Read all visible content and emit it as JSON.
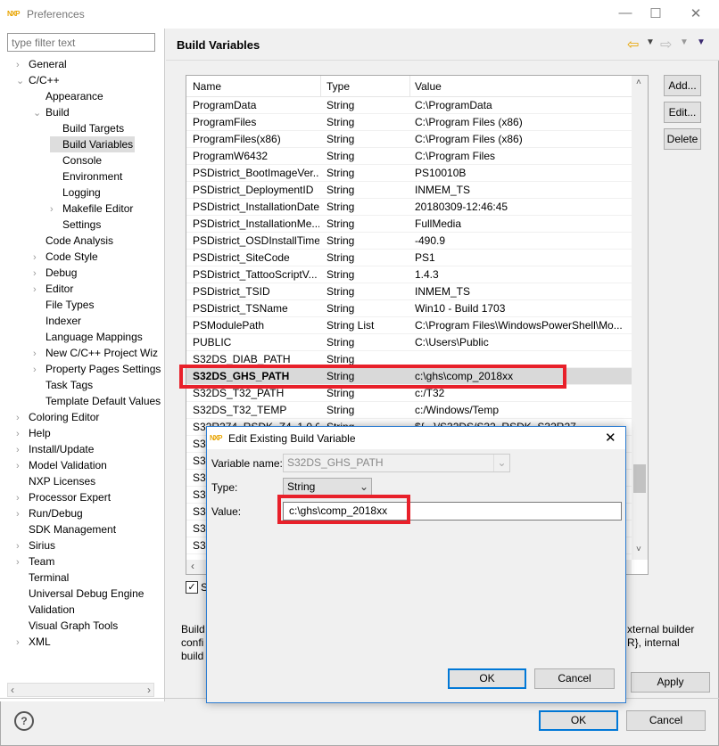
{
  "window": {
    "title": "Preferences",
    "logo": "NXP",
    "minimize": "—",
    "maximize": "☐",
    "close": "✕"
  },
  "sidebar": {
    "filter_placeholder": "type filter text",
    "items": [
      {
        "label": "General",
        "level": 0,
        "twisty": "›"
      },
      {
        "label": "C/C++",
        "level": 0,
        "twisty": "⌄"
      },
      {
        "label": "Appearance",
        "level": 1,
        "twisty": ""
      },
      {
        "label": "Build",
        "level": 1,
        "twisty": "⌄"
      },
      {
        "label": "Build Targets",
        "level": 2,
        "twisty": ""
      },
      {
        "label": "Build Variables",
        "level": 2,
        "twisty": "",
        "selected": true
      },
      {
        "label": "Console",
        "level": 2,
        "twisty": ""
      },
      {
        "label": "Environment",
        "level": 2,
        "twisty": ""
      },
      {
        "label": "Logging",
        "level": 2,
        "twisty": ""
      },
      {
        "label": "Makefile Editor",
        "level": 2,
        "twisty": "›"
      },
      {
        "label": "Settings",
        "level": 2,
        "twisty": ""
      },
      {
        "label": "Code Analysis",
        "level": 1,
        "twisty": ""
      },
      {
        "label": "Code Style",
        "level": 1,
        "twisty": "›"
      },
      {
        "label": "Debug",
        "level": 1,
        "twisty": "›"
      },
      {
        "label": "Editor",
        "level": 1,
        "twisty": "›"
      },
      {
        "label": "File Types",
        "level": 1,
        "twisty": ""
      },
      {
        "label": "Indexer",
        "level": 1,
        "twisty": ""
      },
      {
        "label": "Language Mappings",
        "level": 1,
        "twisty": ""
      },
      {
        "label": "New C/C++ Project Wiz",
        "level": 1,
        "twisty": "›"
      },
      {
        "label": "Property Pages Settings",
        "level": 1,
        "twisty": "›"
      },
      {
        "label": "Task Tags",
        "level": 1,
        "twisty": ""
      },
      {
        "label": "Template Default Values",
        "level": 1,
        "twisty": ""
      },
      {
        "label": "Coloring Editor",
        "level": 0,
        "twisty": "›"
      },
      {
        "label": "Help",
        "level": 0,
        "twisty": "›"
      },
      {
        "label": "Install/Update",
        "level": 0,
        "twisty": "›"
      },
      {
        "label": "Model Validation",
        "level": 0,
        "twisty": "›"
      },
      {
        "label": "NXP Licenses",
        "level": 0,
        "twisty": ""
      },
      {
        "label": "Processor Expert",
        "level": 0,
        "twisty": "›"
      },
      {
        "label": "Run/Debug",
        "level": 0,
        "twisty": "›"
      },
      {
        "label": "SDK Management",
        "level": 0,
        "twisty": ""
      },
      {
        "label": "Sirius",
        "level": 0,
        "twisty": "›"
      },
      {
        "label": "Team",
        "level": 0,
        "twisty": "›"
      },
      {
        "label": "Terminal",
        "level": 0,
        "twisty": ""
      },
      {
        "label": "Universal Debug Engine",
        "level": 0,
        "twisty": ""
      },
      {
        "label": "Validation",
        "level": 0,
        "twisty": ""
      },
      {
        "label": "Visual Graph Tools",
        "level": 0,
        "twisty": ""
      },
      {
        "label": "XML",
        "level": 0,
        "twisty": "›"
      }
    ]
  },
  "page": {
    "title": "Build Variables",
    "nav": {
      "back": "⇦",
      "forward": "⇨",
      "menu": "▾"
    }
  },
  "table": {
    "columns": [
      "Name",
      "Type",
      "Value"
    ],
    "rows": [
      [
        "ProgramData",
        "String",
        "C:\\ProgramData"
      ],
      [
        "ProgramFiles",
        "String",
        "C:\\Program Files (x86)"
      ],
      [
        "ProgramFiles(x86)",
        "String",
        "C:\\Program Files (x86)"
      ],
      [
        "ProgramW6432",
        "String",
        "C:\\Program Files"
      ],
      [
        "PSDistrict_BootImageVer...",
        "String",
        "PS10010B"
      ],
      [
        "PSDistrict_DeploymentID",
        "String",
        "INMEM_TS"
      ],
      [
        "PSDistrict_InstallationDate",
        "String",
        "20180309-12:46:45"
      ],
      [
        "PSDistrict_InstallationMe...",
        "String",
        "FullMedia"
      ],
      [
        "PSDistrict_OSDInstallTime",
        "String",
        "-490.9"
      ],
      [
        "PSDistrict_SiteCode",
        "String",
        "PS1"
      ],
      [
        "PSDistrict_TattooScriptV...",
        "String",
        "1.4.3"
      ],
      [
        "PSDistrict_TSID",
        "String",
        "INMEM_TS"
      ],
      [
        "PSDistrict_TSName",
        "String",
        "Win10 - Build 1703"
      ],
      [
        "PSModulePath",
        "String List",
        "C:\\Program Files\\WindowsPowerShell\\Mo..."
      ],
      [
        "PUBLIC",
        "String",
        "C:\\Users\\Public"
      ],
      [
        "S32DS_DIAB_PATH",
        "String",
        ""
      ],
      [
        "S32DS_GHS_PATH",
        "String",
        "c:\\ghs\\comp_2018xx"
      ],
      [
        "S32DS_T32_PATH",
        "String",
        "c:/T32"
      ],
      [
        "S32DS_T32_TEMP",
        "String",
        "c:/Windows/Temp"
      ],
      [
        "S32R274_RSDK_Z4_1.0.0",
        "String",
        "${...}/S32DS/S32_RSDK_S32R27"
      ],
      [
        "S3",
        "",
        ""
      ],
      [
        "S3",
        "",
        ""
      ],
      [
        "S3",
        "",
        ""
      ],
      [
        "S3",
        "",
        ""
      ],
      [
        "S3",
        "",
        ""
      ],
      [
        "S3",
        "",
        ""
      ],
      [
        "S3",
        "",
        ""
      ]
    ],
    "selected_index": 16
  },
  "buttons": {
    "add": "Add...",
    "edit": "Edit...",
    "delete": "Delete",
    "apply": "Apply",
    "ok": "OK",
    "cancel": "Cancel"
  },
  "checkbox": {
    "label": "S",
    "checked": true
  },
  "description": {
    "left": [
      "Build",
      "confi",
      "build"
    ],
    "right": [
      "xternal builder",
      "R}, internal",
      ""
    ]
  },
  "help_icon": "?",
  "dialog": {
    "title": "Edit Existing Build Variable",
    "close": "✕",
    "variable_name_label": "Variable name:",
    "variable_name": "S32DS_GHS_PATH",
    "type_label": "Type:",
    "type": "String",
    "value_label": "Value:",
    "value": "c:\\ghs\\comp_2018xx",
    "ok": "OK",
    "cancel": "Cancel"
  },
  "colors": {
    "highlight": "#e8202a",
    "default_button": "#0078d7",
    "selected_row": "#d9d9d9"
  }
}
